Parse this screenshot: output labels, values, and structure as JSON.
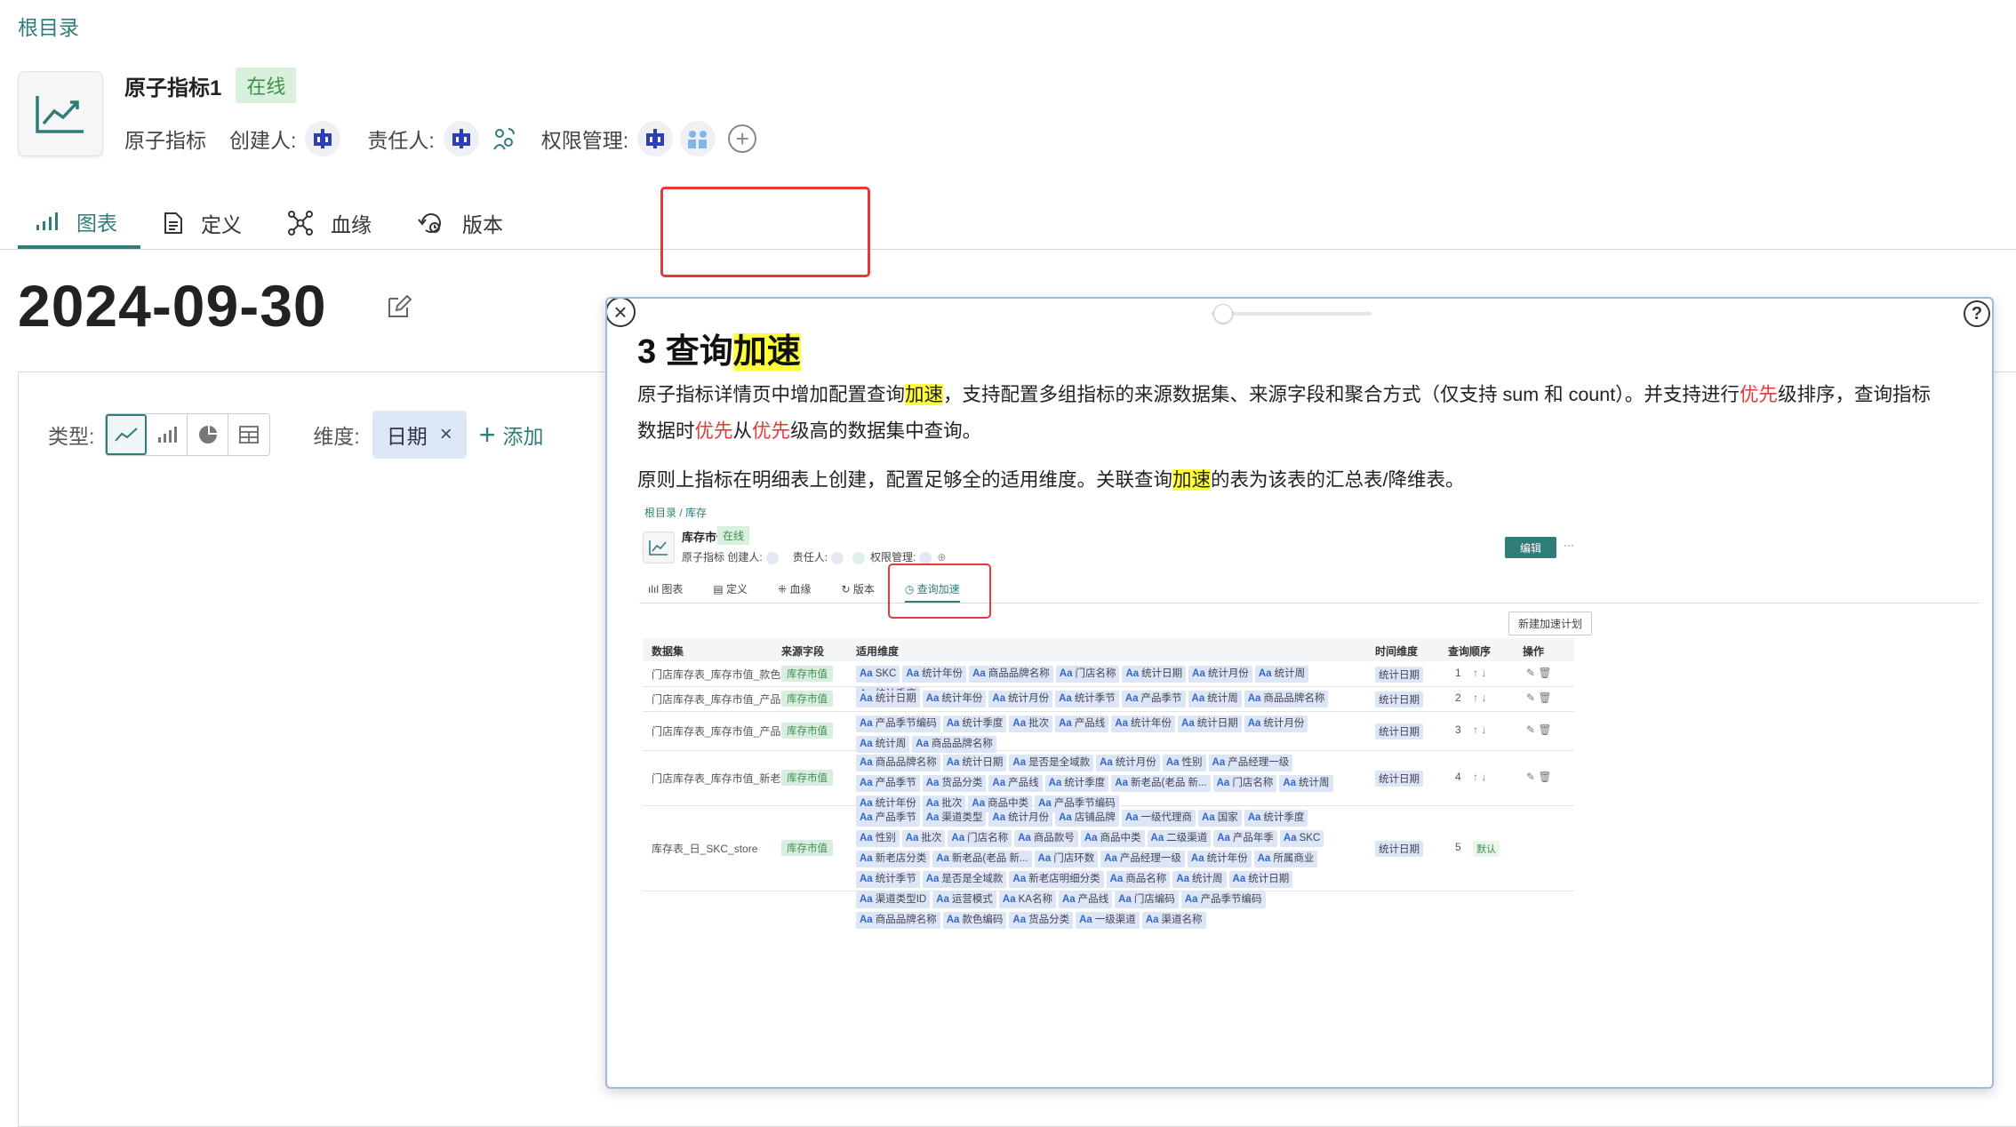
{
  "breadcrumb": "根目录",
  "header": {
    "title": "原子指标1",
    "status": "在线",
    "type_label": "原子指标",
    "creator_label": "创建人:",
    "owner_label": "责任人:",
    "permission_label": "权限管理:"
  },
  "tabs": [
    {
      "label": "图表",
      "icon": "bar-chart-icon",
      "active": true
    },
    {
      "label": "定义",
      "icon": "document-icon",
      "active": false
    },
    {
      "label": "血缘",
      "icon": "lineage-icon",
      "active": false
    },
    {
      "label": "版本",
      "icon": "history-icon",
      "active": false
    }
  ],
  "date_title": "2024-09-30",
  "toolbar": {
    "type_label": "类型:",
    "dimension_label": "维度:",
    "dimension_chip": "日期",
    "add_label": "添加"
  },
  "popup": {
    "heading_prefix": "3 查询",
    "heading_highlight": "加速",
    "p1": [
      {
        "text": "原子指标详情页中增加配置查询",
        "style": ""
      },
      {
        "text": "加速",
        "style": "hl"
      },
      {
        "text": "，支持配置多组指标的来源数据集、来源字段和聚合方式（仅支持 sum 和 count）。并支持进行",
        "style": ""
      },
      {
        "text": "优先",
        "style": "red"
      },
      {
        "text": "级排序，查询指标",
        "style": ""
      }
    ],
    "p1b": [
      {
        "text": "数据时",
        "style": ""
      },
      {
        "text": "优先",
        "style": "red"
      },
      {
        "text": "从",
        "style": ""
      },
      {
        "text": "优先",
        "style": "red"
      },
      {
        "text": "级高的数据集中查询。",
        "style": ""
      }
    ],
    "p2": [
      {
        "text": "原则上指标在明细表上创建，配置足够全的适用维度。关联查询",
        "style": ""
      },
      {
        "text": "加速",
        "style": "hl"
      },
      {
        "text": "的表为该表的汇总表/降维表。",
        "style": ""
      }
    ],
    "help": "?"
  },
  "inner": {
    "breadcrumb": "根目录 / 库存",
    "title": "库存市值",
    "status": "在线",
    "meta": "原子指标   创建人:",
    "owner": "责任人:",
    "permission": "权限管理:",
    "edit": "编辑",
    "more": "···",
    "tabs": [
      "图表",
      "定义",
      "血缘",
      "版本",
      "查询加速"
    ],
    "new_plan": "新建加速计划",
    "columns": [
      "数据集",
      "来源字段",
      "适用维度",
      "时间维度",
      "查询顺序",
      "操作"
    ],
    "rows": [
      {
        "dataset": "门店库存表_库存市值_款色编码",
        "source": "库存市值",
        "dims": [
          "SKC",
          "统计年份",
          "商品品牌名称",
          "门店名称",
          "统计日期",
          "统计月份",
          "统计周",
          "统计季度"
        ],
        "time": "统计日期",
        "order": "1"
      },
      {
        "dataset": "门店库存表_库存市值_产品季",
        "source": "库存市值",
        "dims": [
          "统计日期",
          "统计年份",
          "统计月份",
          "统计季节",
          "产品季节",
          "统计周",
          "商品品牌名称"
        ],
        "time": "统计日期",
        "order": "2"
      },
      {
        "dataset": "门店库存表_库存市值_产品线",
        "source": "库存市值",
        "dims": [
          "产品季节编码",
          "统计季度",
          "批次",
          "产品线",
          "统计年份",
          "统计日期",
          "统计月份",
          "统计周",
          "商品品牌名称"
        ],
        "time": "统计日期",
        "order": "3"
      },
      {
        "dataset": "门店库存表_库存市值_新老品",
        "source": "库存市值",
        "dims": [
          "商品品牌名称",
          "统计日期",
          "是否是全域款",
          "统计月份",
          "性别",
          "产品经理一级",
          "产品季节",
          "货品分类",
          "产品线",
          "统计季度",
          "新老品(老品 新...",
          "门店名称",
          "统计周",
          "统计年份",
          "批次",
          "商品中类",
          "产品季节编码"
        ],
        "time": "统计日期",
        "order": "4"
      },
      {
        "dataset": "库存表_日_SKC_store",
        "source": "库存市值",
        "dims": [
          "产品季节",
          "渠道类型",
          "统计月份",
          "店铺品牌",
          "一级代理商",
          "国家",
          "统计季度",
          "性别",
          "批次",
          "门店名称",
          "商品款号",
          "商品中类",
          "二级渠道",
          "产品年季",
          "SKC",
          "新老店分类",
          "新老品(老品 新...",
          "门店环数",
          "产品经理一级",
          "统计年份",
          "所属商业",
          "统计季节",
          "是否是全域款",
          "新老店明细分类",
          "商品名称",
          "统计周",
          "统计日期",
          "渠道类型ID",
          "运营模式",
          "KA名称",
          "产品线",
          "门店编码",
          "产品季节编码",
          "商品品牌名称",
          "款色编码",
          "货品分类",
          "一级渠道",
          "渠道名称"
        ],
        "time": "统计日期",
        "order": "5",
        "tag": "默认"
      }
    ]
  },
  "colors": {
    "accent": "#2f7d78",
    "status_bg": "#d9f0dc",
    "highlight": "#ffff3b",
    "red": "#e53a3a",
    "annotation": "#e53a3a"
  }
}
